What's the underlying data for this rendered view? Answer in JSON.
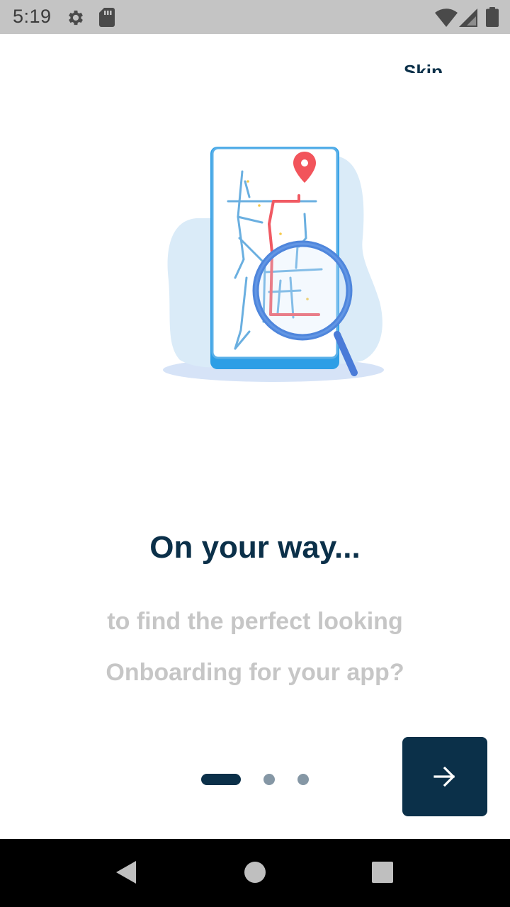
{
  "status_bar": {
    "time": "5:19",
    "icons": [
      "gear-icon",
      "sd-card-icon",
      "wifi-icon",
      "signal-icon",
      "battery-icon"
    ]
  },
  "header": {
    "skip_label": "Skip"
  },
  "onboarding": {
    "illustration": "map-search-illustration",
    "title": "On your way...",
    "subtitle_line1": "to find the perfect looking",
    "subtitle_line2": "Onboarding for your app?",
    "page_count": 3,
    "current_page": 1,
    "next_icon": "arrow-right-icon"
  },
  "nav_bar": {
    "icons": [
      "back-icon",
      "home-icon",
      "recents-icon"
    ]
  },
  "colors": {
    "primary": "#0b3049",
    "subtitle": "#c6c6c6",
    "indicator_inactive": "#8597a5",
    "status_bar": "#c4c4c4",
    "map_line_blue": "#6aafe0",
    "route_red": "#f05a63",
    "pin_red": "#f2545b",
    "blob_light_blue": "#d9ecf8"
  }
}
